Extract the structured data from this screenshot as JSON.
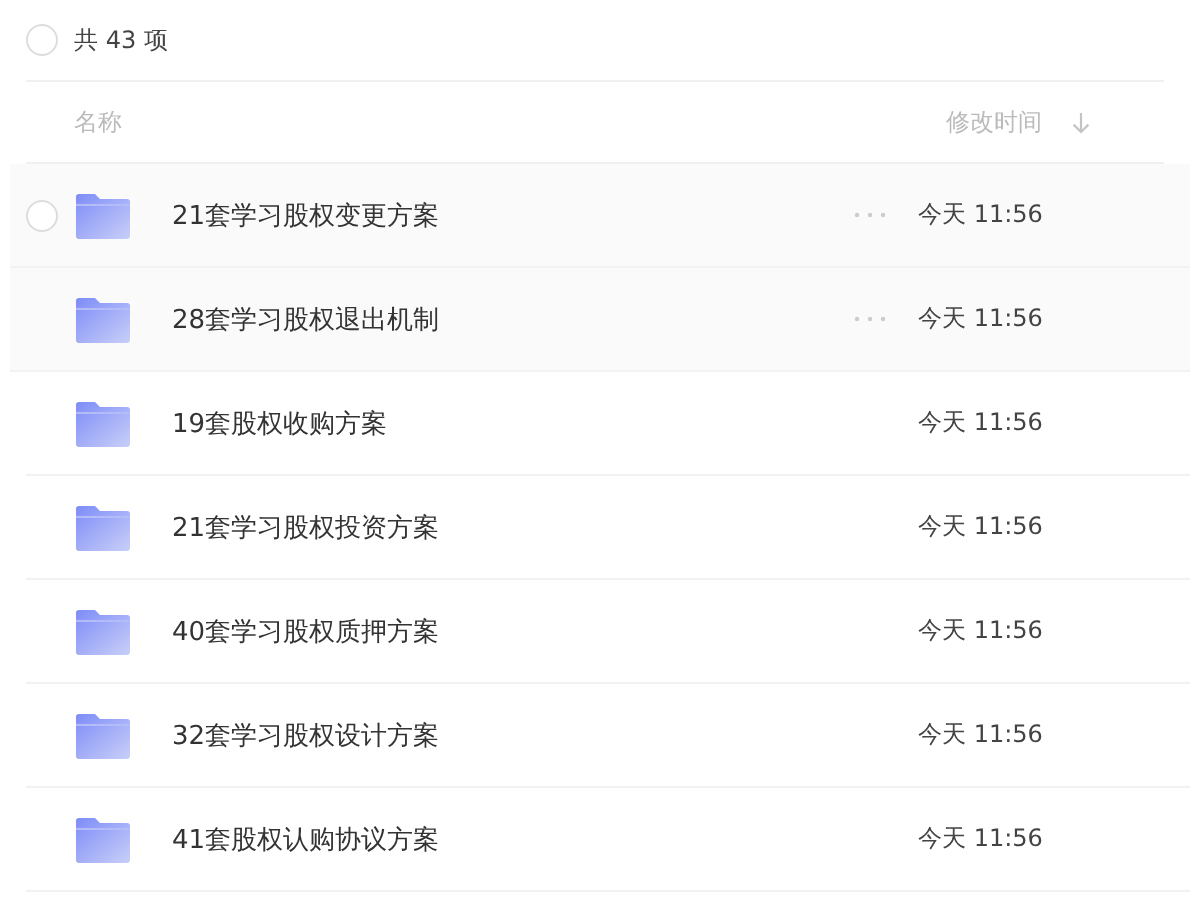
{
  "summary": {
    "text": "共 43 项",
    "checked": false
  },
  "columns": [
    {
      "label": "名称"
    },
    {
      "label": "修改时间",
      "sorted": true
    }
  ],
  "rows": [
    {
      "name": "21套学习股权变更方案",
      "time": "今天 11:56",
      "hovered": true,
      "checked": false
    },
    {
      "name": "28套学习股权退出机制",
      "time": "今天 11:56",
      "hovered": true
    },
    {
      "name": "19套股权收购方案",
      "time": "今天 11:56",
      "hovered": false
    },
    {
      "name": "21套学习股权投资方案",
      "time": "今天 11:56",
      "hovered": false
    },
    {
      "name": "40套学习股权质押方案",
      "time": "今天 11:56",
      "hovered": false
    },
    {
      "name": "32套学习股权设计方案",
      "time": "今天 11:56",
      "hovered": false
    },
    {
      "name": "41套股权认购协议方案",
      "time": "今天 11:56",
      "hovered": false
    }
  ]
}
